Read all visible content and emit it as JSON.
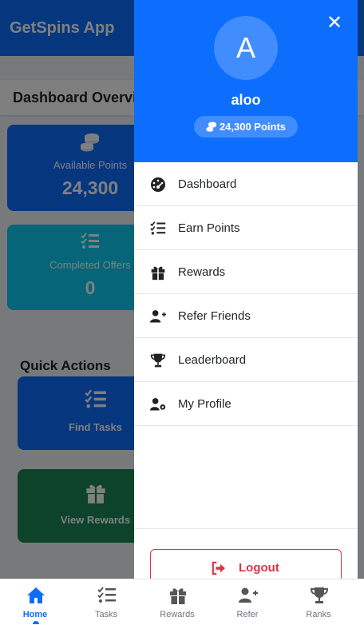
{
  "app": {
    "title": "GetSpins App"
  },
  "dashboard": {
    "heading": "Dashboard Overview",
    "cards": [
      {
        "label": "Available Points",
        "value": "24,300",
        "icon": "coins-icon"
      },
      {
        "label": "Completed Offers",
        "value": "0",
        "icon": "list-check-icon"
      }
    ]
  },
  "quick_actions": {
    "title": "Quick Actions",
    "items": [
      {
        "label": "Find Tasks",
        "icon": "list-check-icon"
      },
      {
        "label": "View Rewards",
        "icon": "gift-icon"
      }
    ]
  },
  "drawer": {
    "close_icon": "close-icon",
    "avatar_letter": "A",
    "user_name": "aloo",
    "points": "24,300 Points",
    "menu": [
      {
        "label": "Dashboard",
        "icon": "gauge-icon"
      },
      {
        "label": "Earn Points",
        "icon": "list-check-icon"
      },
      {
        "label": "Rewards",
        "icon": "gift-icon"
      },
      {
        "label": "Refer Friends",
        "icon": "user-plus-icon"
      },
      {
        "label": "Leaderboard",
        "icon": "trophy-icon"
      },
      {
        "label": "My Profile",
        "icon": "user-gear-icon"
      }
    ],
    "logout": "Logout"
  },
  "bottom_nav": [
    {
      "label": "Home",
      "icon": "home-icon",
      "active": true
    },
    {
      "label": "Tasks",
      "icon": "list-check-icon"
    },
    {
      "label": "Rewards",
      "icon": "gift-icon"
    },
    {
      "label": "Refer",
      "icon": "user-plus-icon"
    },
    {
      "label": "Ranks",
      "icon": "trophy-icon"
    }
  ],
  "colors": {
    "primary": "#0d6efd",
    "cyan": "#0dcaf0",
    "green": "#198754",
    "danger": "#dc3545"
  }
}
